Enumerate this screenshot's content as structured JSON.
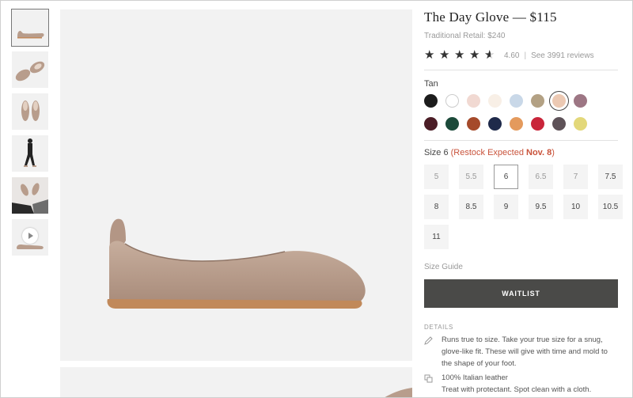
{
  "product": {
    "title": "The Day Glove — $115",
    "retail": "Traditional Retail: $240",
    "rating_value": "4.60",
    "rating_sep": "|",
    "reviews_link": "See 3991 reviews",
    "stars": 4.6
  },
  "color": {
    "label": "Tan",
    "swatches": [
      "#1c1c1c",
      "#ffffff",
      "#f1d9d2",
      "#f8efe6",
      "#c9d8e8",
      "#b3a184",
      "#ecc9b3",
      "#9d7684",
      "#4b1d26",
      "#1c4a3a",
      "#a54a2b",
      "#1f2a4a",
      "#e49a5d",
      "#c9253a",
      "#5e5258",
      "#e3d87a"
    ],
    "selected_index": 6
  },
  "size": {
    "label": "Size 6",
    "restock_prefix": "(Restock Expected ",
    "restock_date": "Nov. 8",
    "restock_suffix": ")",
    "options": [
      "5",
      "5.5",
      "6",
      "6.5",
      "7",
      "7.5",
      "8",
      "8.5",
      "9",
      "9.5",
      "10",
      "10.5",
      "11"
    ],
    "selected": "6",
    "available": [
      "8",
      "8.5",
      "9",
      "9.5",
      "10",
      "10.5",
      "11",
      "6",
      "7.5"
    ]
  },
  "size_guide": "Size Guide",
  "waitlist_label": "WAITLIST",
  "details": {
    "heading": "DETAILS",
    "fit": "Runs true to size. Take your true size for a snug, glove-like fit. These will give with time and mold to the shape of your foot.",
    "material_line1": "100% Italian leather",
    "material_line2": "Treat with protectant. Spot clean with a cloth."
  },
  "colors": {
    "accent": "#4a4a48",
    "restock": "#c9533b",
    "shoe": "#b89d8c",
    "sole": "#c1895a"
  }
}
